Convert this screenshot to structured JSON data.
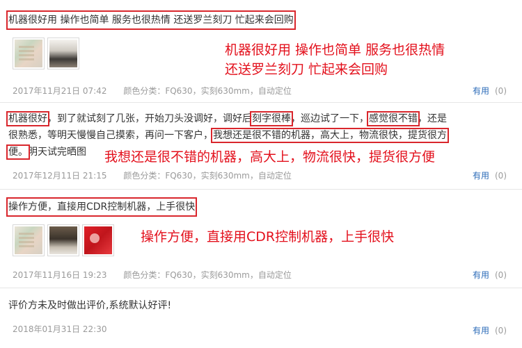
{
  "reviews": [
    {
      "text": "机器很好用 操作也简单 服务也很热情 还送罗兰刻刀 忙起来会回购",
      "annotation_lines": [
        "机器很好用 操作也简单 服务也很热情",
        "还送罗兰刻刀 忙起来会回购"
      ],
      "date": "2017年11月21日 07:42",
      "spec": "颜色分类：FQ630，实刻630mm，自动定位",
      "useful_label": "有用",
      "useful_count": "(0)"
    },
    {
      "text_lines": [
        [
          "机器很好",
          "，到了就试刻了几张，开始刀头没调好，调好后",
          "刻字很棒",
          "，巡边试了一下，",
          "感觉很不错",
          "，还是"
        ],
        [
          "很熟悉，等明天慢慢自己摸索，再问一下客户，",
          "我想还是很不错的机器，高大上，物流很快，提货很方"
        ],
        [
          "便。",
          "明天试完晒图"
        ]
      ],
      "annotation": "我想还是很不错的机器，高大上，物流很快，提货很方便",
      "date": "2017年12月11日 21:15",
      "spec": "颜色分类：FQ630，实刻630mm，自动定位",
      "useful_label": "有用",
      "useful_count": "(0)"
    },
    {
      "text": "操作方便，直接用CDR控制机器，上手很快",
      "annotation": "操作方便，直接用CDR控制机器，上手很快",
      "date": "2017年11月16日 19:23",
      "spec": "颜色分类：FQ630，实刻630mm，自动定位",
      "useful_label": "有用",
      "useful_count": "(0)"
    },
    {
      "text": "评价方未及时做出评价,系统默认好评!",
      "date": "2018年01月31日 22:30",
      "useful_label": "有用",
      "useful_count": "(0)"
    }
  ],
  "colors": {
    "annotation": "#e3101c",
    "highlight_box": "#d9262c",
    "link": "#2b6bb8",
    "meta": "#9a9a9a"
  }
}
